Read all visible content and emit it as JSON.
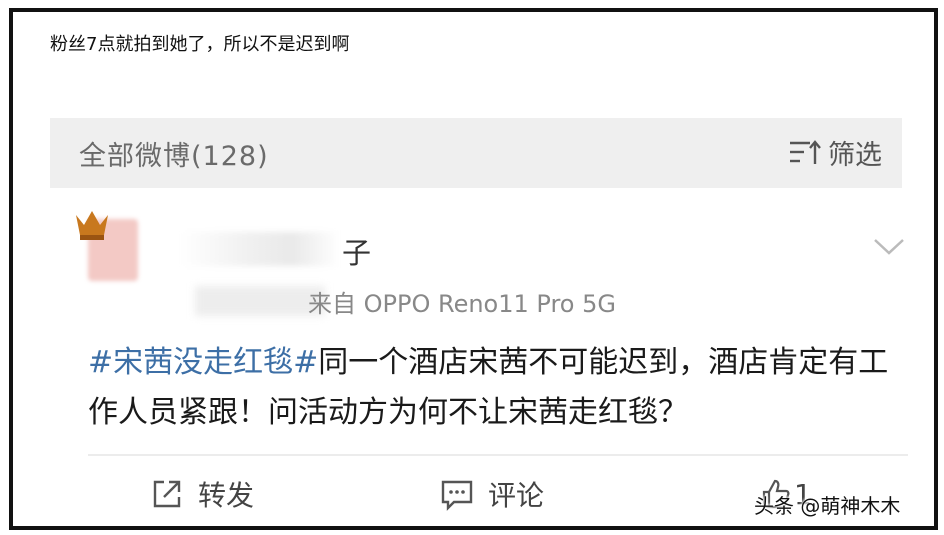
{
  "caption": "粉丝7点就拍到她了，所以不是迟到啊",
  "header": {
    "title": "全部微博(128)",
    "filter_label": "筛选"
  },
  "post": {
    "username_visible": "子",
    "source": "来自 OPPO Reno11 Pro 5G",
    "hashtag": "#宋茜没走红毯#",
    "body": "同一个酒店宋茜不可能迟到，酒店肯定有工作人员紧跟！问活动方为何不让宋茜走红毯？"
  },
  "actions": {
    "repost_label": "转发",
    "comment_label": "评论",
    "like_count": "1"
  },
  "watermark": "头条 @萌神木木",
  "colors": {
    "hashtag": "#3d6fa6",
    "header_bg": "#efefef"
  },
  "icons": [
    "filter-icon",
    "chevron-down-icon",
    "share-icon",
    "comment-icon",
    "like-icon"
  ]
}
